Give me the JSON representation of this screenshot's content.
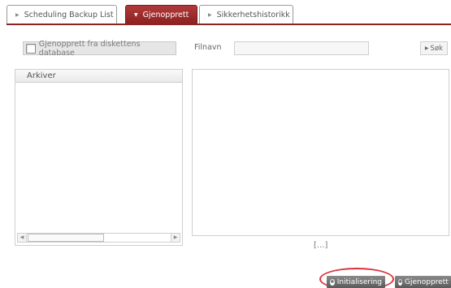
{
  "tabs": [
    {
      "label": "Scheduling Backup List",
      "active": false
    },
    {
      "label": "Gjenopprett",
      "active": true
    },
    {
      "label": "Sikkerhetshistorikk",
      "active": false
    }
  ],
  "disk_restore": {
    "label": "Gjenopprett fra diskettens database",
    "checked": false
  },
  "filename": {
    "label": "Filnavn",
    "value": "",
    "placeholder": ""
  },
  "search_button": {
    "label": "Søk"
  },
  "archive_panel": {
    "title": "Arkiver",
    "items": []
  },
  "content_panel": {
    "ellipsis": "[...]"
  },
  "actions": {
    "init_label": "Initialisering",
    "restore_label": "Gjenopprett"
  },
  "colors": {
    "accent": "#8d2424",
    "highlight_ring": "#d9343f"
  }
}
